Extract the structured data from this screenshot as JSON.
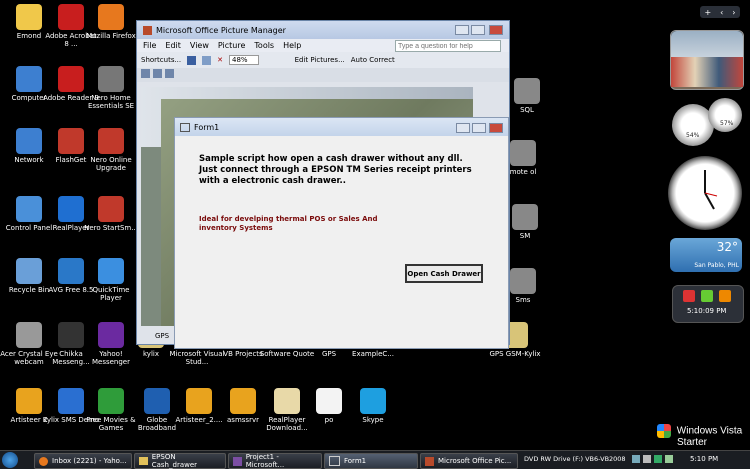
{
  "desktop_icons": [
    {
      "label": "Emond",
      "color": "#f0c84a"
    },
    {
      "label": "Adobe Acrobat 8 ...",
      "color": "#c81e1e"
    },
    {
      "label": "Mozilla Firefox",
      "color": "#e7781e"
    },
    {
      "label": "Computer",
      "color": "#3d7fd0"
    },
    {
      "label": "Adobe Reader 9",
      "color": "#c81e1e"
    },
    {
      "label": "Nero Home Essentials SE",
      "color": "#777777"
    },
    {
      "label": "Network",
      "color": "#3d7fd0"
    },
    {
      "label": "FlashGet",
      "color": "#c0392b"
    },
    {
      "label": "Nero Online Upgrade",
      "color": "#c0392b"
    },
    {
      "label": "Control Panel",
      "color": "#4a90d9"
    },
    {
      "label": "RealPlayer",
      "color": "#1f6fd1"
    },
    {
      "label": "Nero StartSm...",
      "color": "#c0392b"
    },
    {
      "label": "Recycle Bin",
      "color": "#6a9fd8"
    },
    {
      "label": "AVG Free 8.5",
      "color": "#2a78c8"
    },
    {
      "label": "QuickTime Player",
      "color": "#3b8fe0"
    },
    {
      "label": "Acer Crystal Eye webcam",
      "color": "#999999"
    },
    {
      "label": "Chikka Messeng...",
      "color": "#333333"
    },
    {
      "label": "Yahoo! Messenger",
      "color": "#6b2aa0"
    },
    {
      "label": "Artisteer 2",
      "color": "#e8a31e"
    },
    {
      "label": "Kylix SMS Demo",
      "color": "#2a6fd1"
    },
    {
      "label": "Free Movies & Games",
      "color": "#2f9c3a"
    },
    {
      "label": "Globe Broadband",
      "color": "#1f5fb0"
    },
    {
      "label": "Artisteer_2....",
      "color": "#e8a31e"
    },
    {
      "label": "asmssrvr",
      "color": "#e8a31e"
    },
    {
      "label": "RealPlayer Download...",
      "color": "#e8d9a8"
    },
    {
      "label": "po",
      "color": "#f3f3f3"
    },
    {
      "label": "Skype",
      "color": "#1e9fe0"
    },
    {
      "label": "kylix",
      "color": "#d8c478"
    },
    {
      "label": "Microsoft Visual Stud...",
      "color": "#8a4fb0"
    },
    {
      "label": "VB Projects",
      "color": "#d8c478"
    },
    {
      "label": "Software Quote",
      "color": "#d8c478"
    },
    {
      "label": "GPS",
      "color": "#d8c478"
    },
    {
      "label": "ExampleC...",
      "color": "#d8c478"
    },
    {
      "label": "GPS GSM-Kylix",
      "color": "#d8c478"
    },
    {
      "label": "SQL",
      "color": "#888888"
    },
    {
      "label": "mote ol",
      "color": "#888888"
    },
    {
      "label": "SM",
      "color": "#888888"
    },
    {
      "label": "Sms",
      "color": "#888888"
    }
  ],
  "picture_manager": {
    "title": "Microsoft Office Picture Manager",
    "menu": [
      "File",
      "Edit",
      "View",
      "Picture",
      "Tools",
      "Help"
    ],
    "help_placeholder": "Type a question for help",
    "shortcuts": "Shortcuts...",
    "zoom": "48%",
    "edit_pictures": "Edit Pictures...",
    "auto_correct": "Auto Correct",
    "bottom_label": "GPS"
  },
  "form1": {
    "title": "Form1",
    "description": "Sample script how open a cash drawer without any dll. Just connect  through a EPSON TM Series receipt printers with a electronic cash drawer..",
    "tagline": "Ideal for develping thermal POS or Sales And inventory Systems",
    "button": "Open Cash Drawer"
  },
  "gadgets": {
    "temperature": "32°",
    "location": "San Pablo, PHL",
    "time": "5:10:09 PM",
    "meter_cpu": "54%",
    "meter_mem": "57%"
  },
  "branding": {
    "line1": "Windows Vista",
    "line2": "Starter"
  },
  "taskbar": {
    "items": [
      "Inbox (2221) - Yaho...",
      "EPSON Cash_drawer",
      "Project1 - Microsoft...",
      "Form1",
      "Microsoft Office Pic..."
    ],
    "drive": "DVD RW Drive (F:) VB6-VB2008",
    "clock": "5:10 PM"
  },
  "colors": {
    "accent_red": "#7a0b0b",
    "taskbar": "#1a1d22"
  }
}
